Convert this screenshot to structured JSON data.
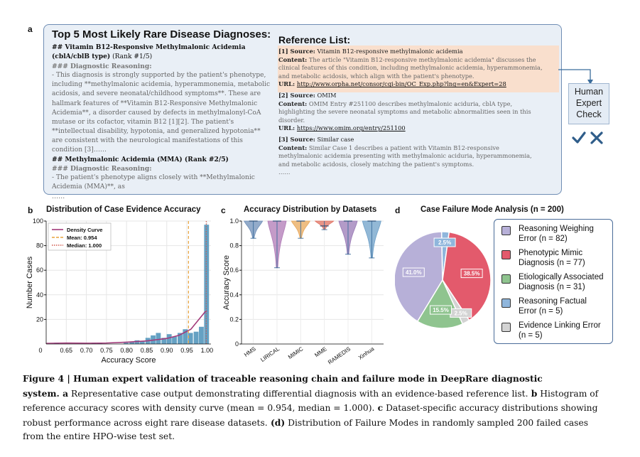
{
  "panel_a": {
    "letter": "a",
    "diagnosis_title": "Top 5 Most Likely Rare Disease Diagnoses:",
    "lines": [
      {
        "kind": "head",
        "text": "## Vitamin B12-Responsive Methylmalonic Acidemia"
      },
      {
        "kind": "head2",
        "text": "(cblA/cblB type)",
        "suffix": " (Rank #1/5)"
      },
      {
        "kind": "sub",
        "text": "### Diagnostic Reasoning:"
      },
      {
        "kind": "body",
        "text": "- This diagnosis is strongly supported by the patient's phenotype,"
      },
      {
        "kind": "body",
        "text": "including **methylmalonic acidemia, hyperammonemia, metabolic"
      },
      {
        "kind": "body",
        "text": "acidosis, and severe neonatal/childhood symptoms**. These are"
      },
      {
        "kind": "body",
        "text": "hallmark features of **Vitamin B12-Responsive Methylmalonic"
      },
      {
        "kind": "body",
        "text": "Acidemia**, a disorder caused by defects in methylmalonyl-CoA"
      },
      {
        "kind": "body",
        "text": "mutase or its cofactor, vitamin B12 [1][2]. The patient's"
      },
      {
        "kind": "body",
        "text": "**intellectual disability, hypotonia, and generalized hypotonia**"
      },
      {
        "kind": "body",
        "text": "are consistent with the neurological manifestations of this"
      },
      {
        "kind": "body",
        "text": "condition [3]……"
      },
      {
        "kind": "head",
        "text": "## Methylmalonic Acidemia (MMA) (Rank #2/5)"
      },
      {
        "kind": "sub",
        "text": "### Diagnostic Reasoning:"
      },
      {
        "kind": "body",
        "text": "- The patient's phenotype aligns closely with **Methylmalonic"
      },
      {
        "kind": "body",
        "text": "Acidemia (MMA)**, as"
      },
      {
        "kind": "body",
        "text": "……"
      }
    ],
    "reference_title": "Reference List:",
    "references": [
      {
        "source_label": "[1] Source:",
        "source": "Vitamin B12-responsive methylmalonic acidemia",
        "content_lines": [
          "Content: The article \"Vitamin B12-responsive methylmalonic acidemia\" discusses the",
          "clinical features of this condition, including methylmalonic acidemia, hyperammonemia,",
          "and metabolic acidosis, which align with the patient's phenotype."
        ],
        "url_label": "URL:",
        "url": "http://www.orpha.net/consor/cgi-bin/OC_Exp.php?lng=en&Expert=28"
      },
      {
        "source_label": "[2] Source:",
        "source": "OMIM",
        "content_lines": [
          "Content: OMIM Entry #251100 describes methylmalonic aciduria, cblA type,",
          "highlighting the severe neonatal symptoms and metabolic abnormalities seen in this",
          "disorder."
        ],
        "url_label": "URL:",
        "url": "https://www.omim.org/entry/251100"
      },
      {
        "source_label": "[3] Source:",
        "source": "Similar case",
        "content_lines": [
          "Content: Similar Case 1 describes a patient with Vitamin B12-responsive",
          "methylmalonic acidemia presenting with methylmalonic aciduria, hyperammonemia,",
          "and metabolic acidosis, closely matching the patient's symptoms."
        ],
        "url_label": "",
        "url": "",
        "trailer": "……"
      }
    ],
    "expert_check": {
      "line1": "Human",
      "line2": "Expert",
      "line3": "Check",
      "check_icon": "checkmark-icon",
      "cross_icon": "cross-icon",
      "icon_color": "#2f5d8a"
    }
  },
  "panel_b": {
    "letter": "b"
  },
  "panel_c": {
    "letter": "c"
  },
  "panel_d": {
    "letter": "d"
  },
  "chart_data": [
    {
      "type": "bar",
      "title": "Distribution of Case Evidence Accuracy",
      "xlabel": "Accuracy Score",
      "ylabel": "Number Cases",
      "xlim": [
        0.6,
        1.01
      ],
      "ylim": [
        0,
        100
      ],
      "xticks": [
        "0",
        "0.65",
        "0.70",
        "0.75",
        "0.80",
        "0.85",
        "0.90",
        "0.95",
        "1.00"
      ],
      "yticks": [
        "20",
        "40",
        "60",
        "80",
        "100"
      ],
      "bins": [
        0.62,
        0.633,
        0.647,
        0.66,
        0.673,
        0.687,
        0.7,
        0.713,
        0.727,
        0.74,
        0.753,
        0.767,
        0.78,
        0.793,
        0.807,
        0.82,
        0.833,
        0.847,
        0.86,
        0.873,
        0.887,
        0.9,
        0.913,
        0.927,
        0.94,
        0.953,
        0.967,
        0.98,
        0.993
      ],
      "values": [
        1,
        0,
        0,
        0,
        0,
        0,
        0,
        1,
        1,
        0,
        0,
        0,
        0,
        1,
        2,
        3,
        2,
        5,
        7,
        9,
        5,
        8,
        6,
        9,
        12,
        9,
        10,
        14,
        97
      ],
      "density_curve": {
        "x": [
          0.6,
          0.65,
          0.7,
          0.75,
          0.8,
          0.85,
          0.9,
          0.93,
          0.96,
          0.98,
          0.995,
          1.0
        ],
        "y": [
          0.5,
          0.8,
          0.6,
          0.8,
          1.5,
          2.5,
          4.5,
          7,
          12,
          20,
          26,
          27
        ]
      },
      "mean": 0.954,
      "median": 1.0,
      "legend": [
        {
          "label": "Density Curve",
          "color": "#a23a7a",
          "style": "solid"
        },
        {
          "label": "Mean: 0.954",
          "color": "#e8a33c",
          "style": "dashed"
        },
        {
          "label": "Median: 1.000",
          "color": "#d1584c",
          "style": "dotted"
        }
      ],
      "bar_color": "#4a90b8",
      "grid": true,
      "legend_placement": "top-left"
    },
    {
      "type": "violin",
      "title": "Accuracy Distribution by Datasets",
      "ylabel": "Accuracy Score",
      "ylim": [
        0,
        1.0
      ],
      "yticks": [
        "0",
        "0.2",
        "0.4",
        "0.6",
        "0.8",
        "1.0"
      ],
      "categories": [
        "HMS",
        "LIRICAL",
        "MIMIC",
        "MME",
        "RAMEDIS",
        "Xinhua"
      ],
      "mins": [
        0.86,
        0.62,
        0.86,
        0.93,
        0.73,
        0.7
      ],
      "medians": [
        1.0,
        1.0,
        1.0,
        0.96,
        1.0,
        1.0
      ],
      "colors": [
        "#6f8fb8",
        "#b07ab6",
        "#e8a85a",
        "#e07060",
        "#9a7ab6",
        "#6ea0c8"
      ],
      "grid": true
    },
    {
      "type": "pie",
      "title": "Case Failure Mode Analysis (n = 200)",
      "slices": [
        {
          "label": "Reasoning Weighing Error (n = 82)",
          "line1": "Reasoning Weighing",
          "line2": "Error (n = 82)",
          "value": 41.0,
          "display": "41.0%",
          "color": "#b7b0d8"
        },
        {
          "label": "Phenotypic Mimic Diagnosis (n = 77)",
          "line1": "Phenotypic Mimic",
          "line2": "Diagnosis (n = 77)",
          "value": 38.5,
          "display": "38.5%",
          "color": "#e35a6c"
        },
        {
          "label": "Etiologically Associated Diagnosis (n = 31)",
          "line1": "Etiologically Associated",
          "line2": "Diagnosis (n = 31)",
          "value": 15.5,
          "display": "15.5%",
          "color": "#8fc48f"
        },
        {
          "label": "Reasoning Factual Error (n = 5)",
          "line1": "Reasoning Factual",
          "line2": "Error (n = 5)",
          "value": 2.5,
          "display": "2.5%",
          "color": "#8fb6dc"
        },
        {
          "label": "Evidence Linking Error (n = 5)",
          "line1": "Evidence Linking Error",
          "line2": "(n = 5)",
          "value": 2.5,
          "display": "2.5%",
          "color": "#d3d3d3"
        }
      ]
    }
  ],
  "caption": {
    "figure_label": "Figure 4 | Human expert validation of traceable reasoning chain and failure mode in DeepRare diagnostic",
    "line2_bold": "system.",
    "line2_a": " a",
    "line2_rest": " Representative case output demonstrating differential diagnosis with an evidence-based reference list.",
    "line2_b": " b",
    "line2_tail": " Histogram of",
    "line3": "reference accuracy scores with density curve (mean = 0.954, median = 1.000).",
    "line3_c": " c",
    "line3_tail": " Dataset-specific accuracy distributions showing",
    "line4": "robust performance across eight rare disease datasets.",
    "line4_d": " (d)",
    "line4_tail": " Distribution of Failure Modes in randomly sampled 200 failed cases",
    "line5": "from the entire HPO-wise test set."
  }
}
